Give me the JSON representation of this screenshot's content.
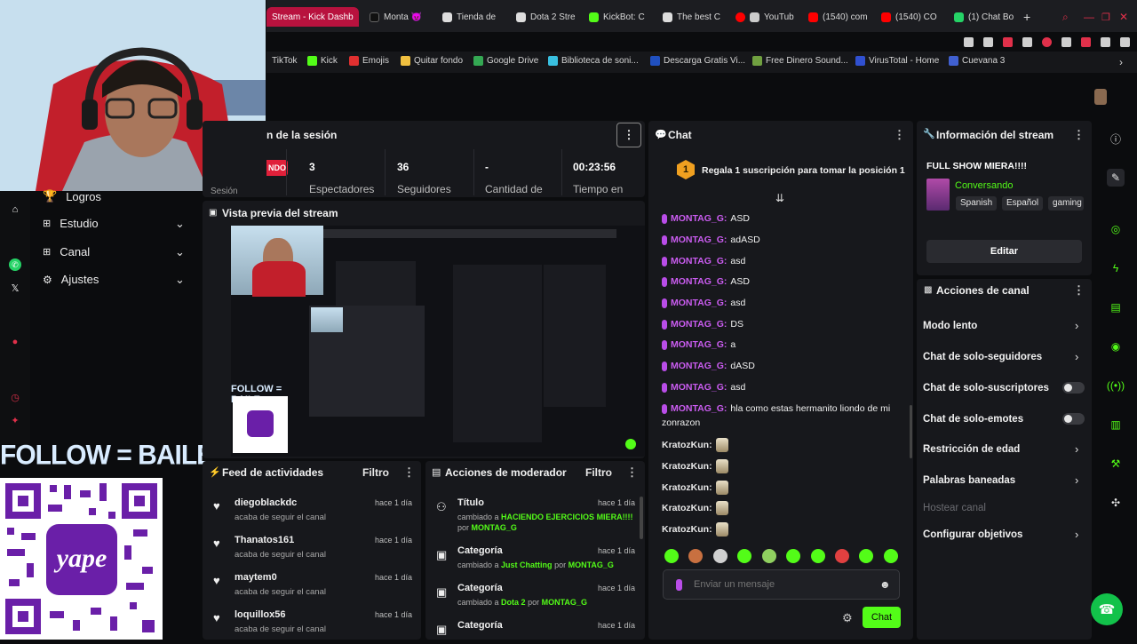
{
  "browser": {
    "tabs": [
      {
        "label": "Stream - Kick Dashb",
        "color": "#b8123e"
      },
      {
        "label": "Monta 😈",
        "color": "#111111"
      },
      {
        "label": "Tienda de",
        "color": "#dddddd"
      },
      {
        "label": "Dota 2 Stre",
        "color": "#dddddd"
      },
      {
        "label": "KickBot: C",
        "color": "#53fc18"
      },
      {
        "label": "The best C",
        "color": "#dddddd"
      },
      {
        "label": "YouTub",
        "color": "#ff0000"
      },
      {
        "label": "(1540) com",
        "color": "#ff0000"
      },
      {
        "label": "(1540) CO",
        "color": "#ff0000"
      },
      {
        "label": "(1) Chat Bo",
        "color": "#25d366"
      }
    ],
    "bookmarks": [
      {
        "label": "TikTok",
        "color": "#111111"
      },
      {
        "label": "Kick",
        "color": "#53fc18"
      },
      {
        "label": "Emojis",
        "color": "#e03030"
      },
      {
        "label": "Quitar fondo",
        "color": "#f0c040"
      },
      {
        "label": "Google Drive",
        "color": "#34a853"
      },
      {
        "label": "Biblioteca de soni...",
        "color": "#39c0e0"
      },
      {
        "label": "Descarga Gratis Vi...",
        "color": "#2050c0"
      },
      {
        "label": "Free Dinero Sound...",
        "color": "#70a040"
      },
      {
        "label": "VirusTotal - Home",
        "color": "#3050d0"
      },
      {
        "label": "Cuevana 3",
        "color": "#4060d0"
      }
    ]
  },
  "sidebar": {
    "items": [
      {
        "label": "Logros",
        "icon": "trophy-icon"
      },
      {
        "label": "Estudio",
        "icon": "grid-icon"
      },
      {
        "label": "Canal",
        "icon": "grid-icon"
      },
      {
        "label": "Ajustes",
        "icon": "gear-icon"
      }
    ]
  },
  "overlay": {
    "follow_text": "FOLLOW = BAILE",
    "qr_brand": "yape"
  },
  "session": {
    "title": "n de la sesión",
    "badge": "NDO",
    "stats": [
      {
        "value": "3",
        "label": "Espectadores"
      },
      {
        "value": "36",
        "label": "Seguidores"
      },
      {
        "value": "-",
        "label": "Cantidad de"
      },
      {
        "value": "00:23:56",
        "label": "Tiempo en"
      }
    ],
    "sub_label": "Sesión"
  },
  "preview": {
    "title": "Vista previa del stream"
  },
  "chat": {
    "title": "Chat",
    "pinned": {
      "rank": "1",
      "text": "Regala 1 suscripción para tomar la posición 1"
    },
    "messages": [
      {
        "user": "MONTAG_G:",
        "text": "ASD"
      },
      {
        "user": "MONTAG_G:",
        "text": "adASD"
      },
      {
        "user": "MONTAG_G:",
        "text": "asd"
      },
      {
        "user": "MONTAG_G:",
        "text": "ASD"
      },
      {
        "user": "MONTAG_G:",
        "text": "asd"
      },
      {
        "user": "MONTAG_G:",
        "text": "DS"
      },
      {
        "user": "MONTAG_G:",
        "text": "a"
      },
      {
        "user": "MONTAG_G:",
        "text": "dASD"
      },
      {
        "user": "MONTAG_G:",
        "text": "asd"
      },
      {
        "user": "MONTAG_G:",
        "text": "hla como estas hermanito liondo de mi"
      },
      {
        "user": "",
        "text": "zonrazon"
      }
    ],
    "emote_messages": [
      {
        "user": "KratozKun:"
      },
      {
        "user": "KratozKun:"
      },
      {
        "user": "KratozKun:"
      },
      {
        "user": "KratozKun:"
      },
      {
        "user": "KratozKun:"
      }
    ],
    "input_placeholder": "Enviar un mensaje",
    "send_label": "Chat",
    "emoji_colors": [
      "#53fc18",
      "#c87040",
      "#d0d0d0",
      "#53fc18",
      "#90d060",
      "#53fc18",
      "#53fc18",
      "#e04040",
      "#53fc18",
      "#53fc18"
    ]
  },
  "info": {
    "title": "Información del stream",
    "stream_title": "FULL SHOW MIERA!!!!",
    "category": "Conversando",
    "tags": [
      "Spanish",
      "Español",
      "gaming"
    ],
    "edit_label": "Editar"
  },
  "channel_actions": {
    "title": "Acciones de canal",
    "items": [
      {
        "label": "Modo lento",
        "control": "chevron"
      },
      {
        "label": "Chat de solo-seguidores",
        "control": "chevron"
      },
      {
        "label": "Chat de solo-suscriptores",
        "control": "toggle"
      },
      {
        "label": "Chat de solo-emotes",
        "control": "toggle"
      },
      {
        "label": "Restricción de edad",
        "control": "chevron"
      },
      {
        "label": "Palabras baneadas",
        "control": "chevron"
      },
      {
        "label": "Hostear canal",
        "control": "disabled"
      },
      {
        "label": "Configurar objetivos",
        "control": "chevron"
      }
    ]
  },
  "feed": {
    "title": "Feed de actividades",
    "filter_label": "Filtro",
    "items": [
      {
        "user": "diegoblackdc",
        "sub": "acaba de seguir el canal",
        "time": "hace 1 día"
      },
      {
        "user": "Thanatos161",
        "sub": "acaba de seguir el canal",
        "time": "hace 1 día"
      },
      {
        "user": "maytem0",
        "sub": "acaba de seguir el canal",
        "time": "hace 1 día"
      },
      {
        "user": "loquillox56",
        "sub": "acaba de seguir el canal",
        "time": "hace 1 día"
      }
    ]
  },
  "moderator": {
    "title": "Acciones de moderador",
    "filter_label": "Filtro",
    "items": [
      {
        "title": "Título",
        "prefix": "cambiado a",
        "value": "HACIENDO EJERCICIOS MIERA!!!!",
        "by_prefix": "por",
        "by": "MONTAG_G",
        "time": "hace 1 día"
      },
      {
        "title": "Categoría",
        "prefix": "cambiado a",
        "value": "Just Chatting",
        "by_prefix": "por",
        "by": "MONTAG_G",
        "time": "hace 1 día"
      },
      {
        "title": "Categoría",
        "prefix": "cambiado a",
        "value": "Dota 2",
        "by_prefix": "por",
        "by": "MONTAG_G",
        "time": "hace 1 día"
      },
      {
        "title": "Categoría",
        "prefix": "",
        "value": "",
        "by_prefix": "",
        "by": "",
        "time": "hace 1 día"
      }
    ]
  },
  "colors": {
    "accent": "#53fc18",
    "panel": "#17181c",
    "chat_user": "#ca5cf0"
  }
}
